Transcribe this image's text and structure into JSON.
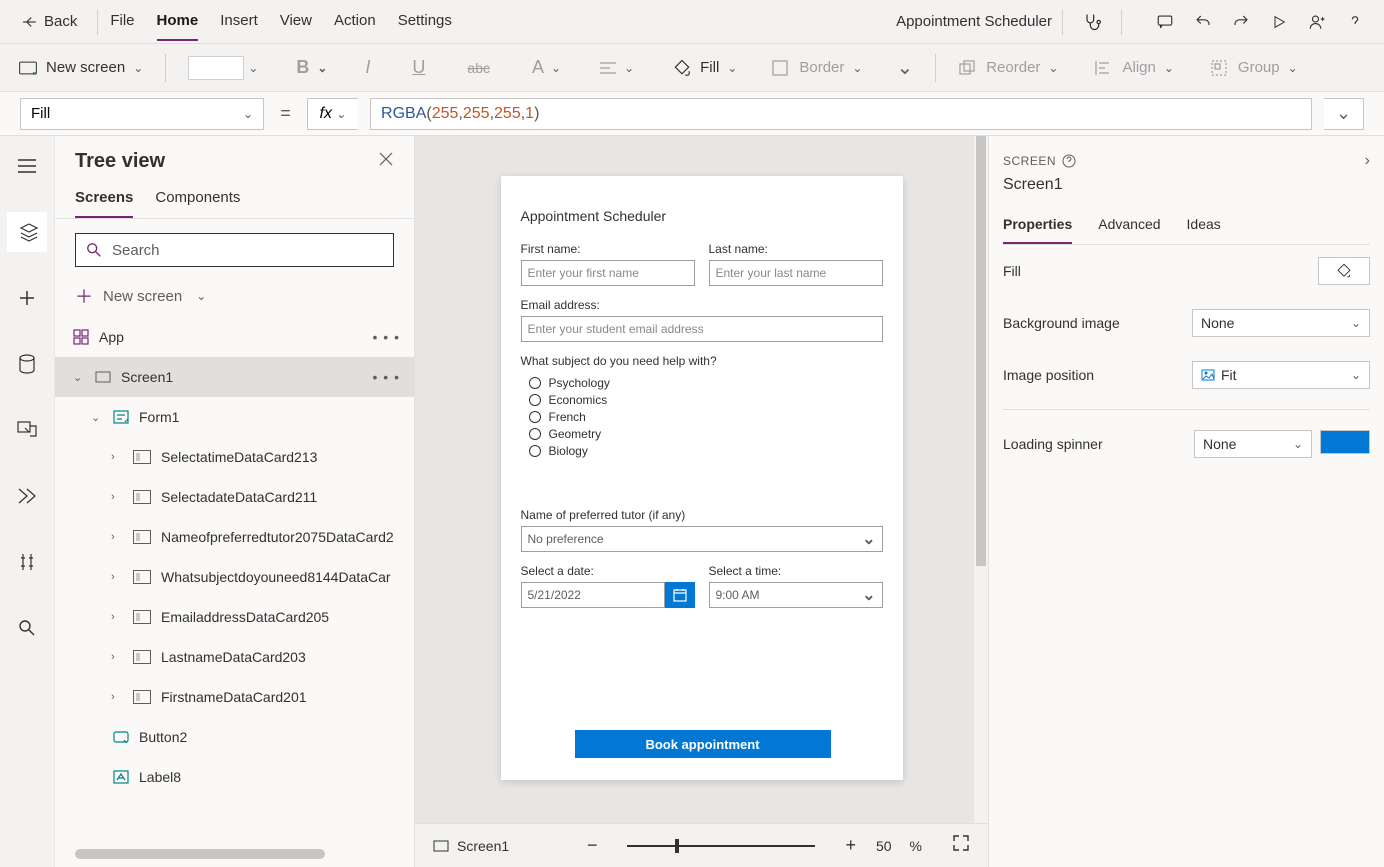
{
  "topbar": {
    "back": "Back",
    "tabs": [
      "File",
      "Home",
      "Insert",
      "View",
      "Action",
      "Settings"
    ],
    "active_tab": "Home",
    "app_title": "Appointment Scheduler"
  },
  "ribbon": {
    "new_screen": "New screen",
    "fill_label": "Fill",
    "border_label": "Border",
    "reorder_label": "Reorder",
    "align_label": "Align",
    "group_label": "Group"
  },
  "formula": {
    "property": "Fill",
    "fx": "fx",
    "func": "RGBA",
    "args": [
      "255",
      "255",
      "255",
      "1"
    ]
  },
  "tree": {
    "title": "Tree view",
    "tabs": [
      "Screens",
      "Components"
    ],
    "active_tab": "Screens",
    "search_placeholder": "Search",
    "new_screen": "New screen",
    "items": [
      {
        "label": "App",
        "level": 1,
        "expandable": false,
        "more": true,
        "icon": "app"
      },
      {
        "label": "Screen1",
        "level": 1,
        "expandable": true,
        "expanded": true,
        "more": true,
        "selected": true,
        "icon": "screen"
      },
      {
        "label": "Form1",
        "level": 2,
        "expandable": true,
        "expanded": true,
        "icon": "form"
      },
      {
        "label": "SelectatimeDataCard213",
        "level": 3,
        "expandable": true,
        "icon": "card"
      },
      {
        "label": "SelectadateDataCard211",
        "level": 3,
        "expandable": true,
        "icon": "card"
      },
      {
        "label": "Nameofpreferredtutor2075DataCard2",
        "level": 3,
        "expandable": true,
        "icon": "card",
        "truncated": true
      },
      {
        "label": "Whatsubjectdoyouneed8144DataCar",
        "level": 3,
        "expandable": true,
        "icon": "card",
        "truncated": true
      },
      {
        "label": "EmailaddressDataCard205",
        "level": 3,
        "expandable": true,
        "icon": "card"
      },
      {
        "label": "LastnameDataCard203",
        "level": 3,
        "expandable": true,
        "icon": "card"
      },
      {
        "label": "FirstnameDataCard201",
        "level": 3,
        "expandable": true,
        "icon": "card"
      },
      {
        "label": "Button2",
        "level": 2,
        "icon": "button"
      },
      {
        "label": "Label8",
        "level": 2,
        "icon": "label"
      }
    ]
  },
  "canvas_app": {
    "title": "Appointment Scheduler",
    "first_name_label": "First name:",
    "first_name_placeholder": "Enter your first name",
    "last_name_label": "Last name:",
    "last_name_placeholder": "Enter your last name",
    "email_label": "Email address:",
    "email_placeholder": "Enter your student email address",
    "subject_label": "What subject do you need help with?",
    "subjects": [
      "Psychology",
      "Economics",
      "French",
      "Geometry",
      "Biology"
    ],
    "tutor_label": "Name of preferred tutor (if any)",
    "tutor_value": "No preference",
    "date_label": "Select a date:",
    "date_value": "5/21/2022",
    "time_label": "Select a time:",
    "time_value": "9:00 AM",
    "book_button": "Book appointment"
  },
  "statusbar": {
    "screen": "Screen1",
    "zoom": "50",
    "zoom_unit": "%"
  },
  "props": {
    "header_label": "SCREEN",
    "name": "Screen1",
    "tabs": [
      "Properties",
      "Advanced",
      "Ideas"
    ],
    "active_tab": "Properties",
    "rows": {
      "fill_label": "Fill",
      "bgimage_label": "Background image",
      "bgimage_value": "None",
      "imgpos_label": "Image position",
      "imgpos_value": "Fit",
      "spinner_label": "Loading spinner",
      "spinner_value": "None"
    }
  }
}
